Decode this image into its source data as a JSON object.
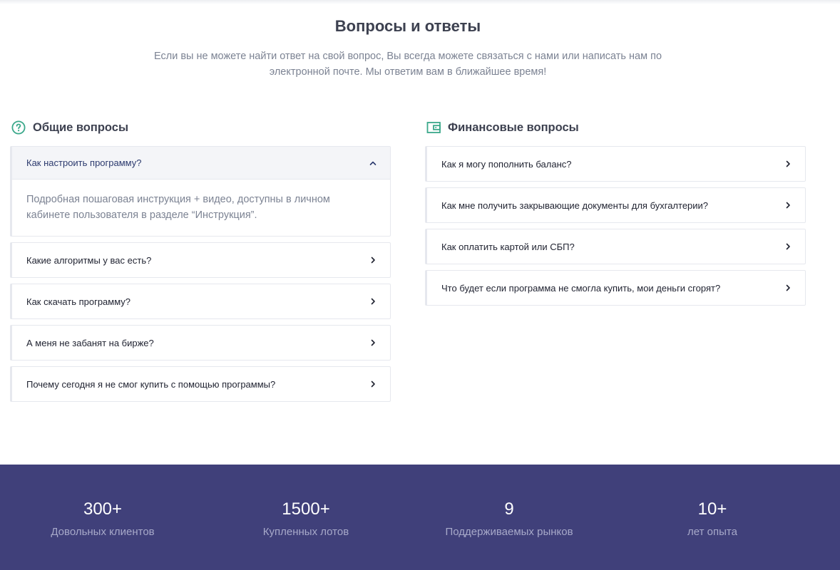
{
  "faq": {
    "title": "Вопросы и ответы",
    "subtitle": "Если вы не можете найти ответ на свой вопрос, Вы всегда можете связаться с нами или написать нам по электронной почте. Мы ответим вам в ближайшее время!"
  },
  "general": {
    "heading": "Общие вопросы",
    "icon": "question-circle-icon",
    "items": [
      {
        "question": "Как настроить программу?",
        "answer": "Подробная пошаговая инструкция + видео, доступны в личном кабинете пользователя в разделе “Инструкция”.",
        "expanded": true
      },
      {
        "question": "Какие алгоритмы у вас есть?",
        "expanded": false
      },
      {
        "question": "Как скачать программу?",
        "expanded": false
      },
      {
        "question": "А меня не забанят на бирже?",
        "expanded": false
      },
      {
        "question": "Почему сегодня я не смог купить с помощью программы?",
        "expanded": false
      }
    ]
  },
  "finance": {
    "heading": "Финансовые вопросы",
    "icon": "wallet-icon",
    "items": [
      {
        "question": "Как я могу пополнить баланс?",
        "expanded": false
      },
      {
        "question": "Как мне получить закрывающие документы для бухгалтерии?",
        "expanded": false
      },
      {
        "question": "Как оплатить картой или СБП?",
        "expanded": false
      },
      {
        "question": "Что будет если программа не смогла купить, мои деньги сгорят?",
        "expanded": false
      }
    ]
  },
  "stats": [
    {
      "value": "300+",
      "label": "Довольных клиентов"
    },
    {
      "value": "1500+",
      "label": "Купленных лотов"
    },
    {
      "value": "9",
      "label": "Поддерживаемых рынков"
    },
    {
      "value": "10+",
      "label": "лет опыта"
    }
  ],
  "colors": {
    "accent": "#3aa88a",
    "stats_background": "#40407a",
    "heading": "#3d4150",
    "muted": "#7c8393"
  }
}
